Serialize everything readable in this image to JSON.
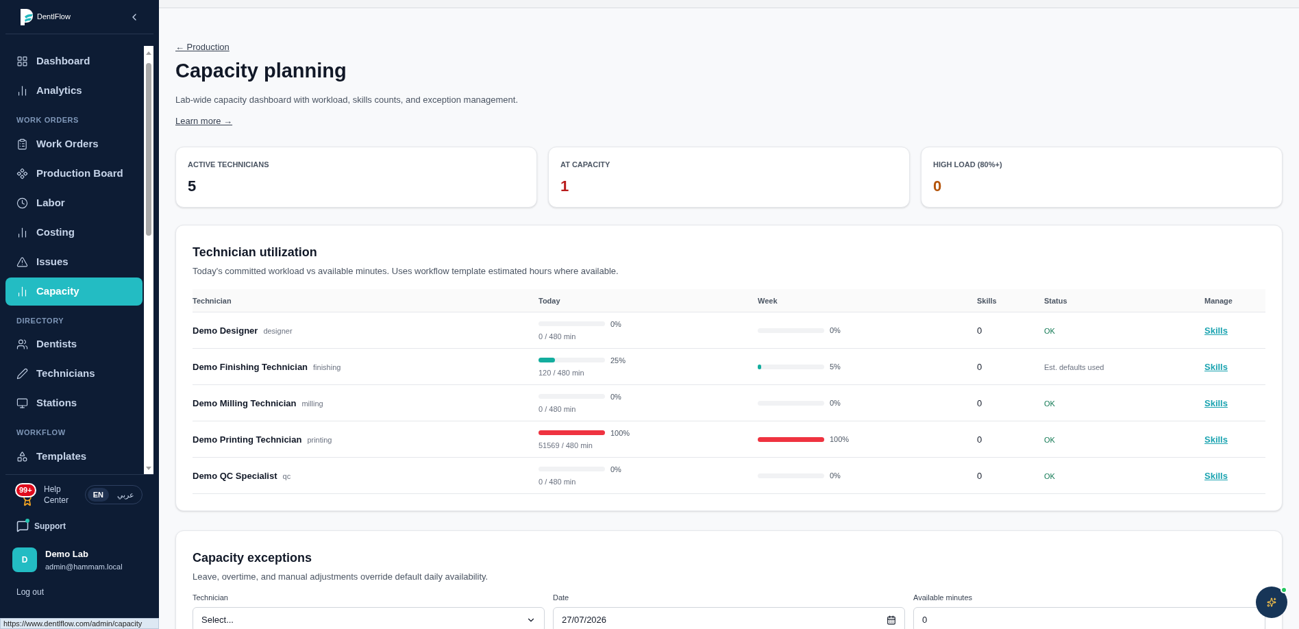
{
  "sidebar": {
    "brand": "DentlFlow",
    "groups": [
      {
        "items": [
          {
            "label": "Dashboard",
            "selected": false
          },
          {
            "label": "Analytics",
            "selected": false
          }
        ]
      },
      {
        "heading": "WORK ORDERS",
        "items": [
          {
            "label": "Work Orders",
            "selected": false
          },
          {
            "label": "Production Board",
            "selected": false
          },
          {
            "label": "Labor",
            "selected": false
          },
          {
            "label": "Costing",
            "selected": false
          },
          {
            "label": "Issues",
            "selected": false
          },
          {
            "label": "Capacity",
            "selected": true
          }
        ]
      },
      {
        "heading": "DIRECTORY",
        "items": [
          {
            "label": "Dentists",
            "selected": false
          },
          {
            "label": "Technicians",
            "selected": false
          },
          {
            "label": "Stations",
            "selected": false
          }
        ]
      },
      {
        "heading": "WORKFLOW",
        "items": [
          {
            "label": "Templates",
            "selected": false
          }
        ]
      }
    ],
    "help": {
      "badge": "99+",
      "label": "Help Center"
    },
    "languages": [
      {
        "label": "EN",
        "selected": true
      },
      {
        "label": "عربي",
        "selected": false
      }
    ],
    "support": "Support",
    "user": {
      "initial": "D",
      "name": "Demo Lab",
      "email": "admin@hammam.local"
    },
    "logout": "Log out"
  },
  "status_url": "https://www.dentlflow.com/admin/capacity",
  "page": {
    "back": "← Production",
    "title": "Capacity planning",
    "subtitle": "Lab-wide capacity dashboard with workload, skills counts, and exception management.",
    "learn_more": "Learn more →"
  },
  "stats": [
    {
      "label": "ACTIVE TECHNICIANS",
      "value": "5",
      "color": "#111827"
    },
    {
      "label": "AT CAPACITY",
      "value": "1",
      "color": "#b91c1c"
    },
    {
      "label": "HIGH LOAD (80%+)",
      "value": "0",
      "color": "#b45309"
    }
  ],
  "utilization": {
    "title": "Technician utilization",
    "subtitle": "Today's committed workload vs available minutes. Uses workflow template estimated hours where available.",
    "columns": [
      "Technician",
      "Today",
      "Week",
      "Skills",
      "Status",
      "Manage"
    ],
    "rows": [
      {
        "name": "Demo Designer",
        "role": "designer",
        "today": {
          "level": 0,
          "percent": "0%",
          "minutes": "0 / 480 min"
        },
        "week": {
          "level": 0,
          "percent": "0%"
        },
        "skills": "0",
        "status": {
          "kind": "ok",
          "text": "OK"
        },
        "manage": "Skills"
      },
      {
        "name": "Demo Finishing Technician",
        "role": "finishing",
        "today": {
          "level": 0.25,
          "percent": "25%",
          "minutes": "120 / 480 min"
        },
        "week": {
          "level": 0.05,
          "percent": "5%"
        },
        "skills": "0",
        "status": {
          "kind": "note",
          "text": "Est. defaults used"
        },
        "manage": "Skills"
      },
      {
        "name": "Demo Milling Technician",
        "role": "milling",
        "today": {
          "level": 0,
          "percent": "0%",
          "minutes": "0 / 480 min"
        },
        "week": {
          "level": 0,
          "percent": "0%"
        },
        "skills": "0",
        "status": {
          "kind": "ok",
          "text": "OK"
        },
        "manage": "Skills"
      },
      {
        "name": "Demo Printing Technician",
        "role": "printing",
        "today": {
          "level": 1,
          "percent": "100%",
          "minutes": "51569 / 480 min"
        },
        "week": {
          "level": 1,
          "percent": "100%"
        },
        "skills": "0",
        "status": {
          "kind": "ok",
          "text": "OK"
        },
        "manage": "Skills"
      },
      {
        "name": "Demo QC Specialist",
        "role": "qc",
        "today": {
          "level": 0,
          "percent": "0%",
          "minutes": "0 / 480 min"
        },
        "week": {
          "level": 0,
          "percent": "0%"
        },
        "skills": "0",
        "status": {
          "kind": "ok",
          "text": "OK"
        },
        "manage": "Skills"
      }
    ]
  },
  "exceptions": {
    "title": "Capacity exceptions",
    "subtitle": "Leave, overtime, and manual adjustments override default daily availability.",
    "fields": [
      {
        "kind": "select",
        "label": "Technician",
        "value": "Select..."
      },
      {
        "kind": "date",
        "label": "Date",
        "value": "27/07/2026"
      },
      {
        "kind": "text",
        "label": "Available minutes",
        "value": "0"
      }
    ]
  }
}
